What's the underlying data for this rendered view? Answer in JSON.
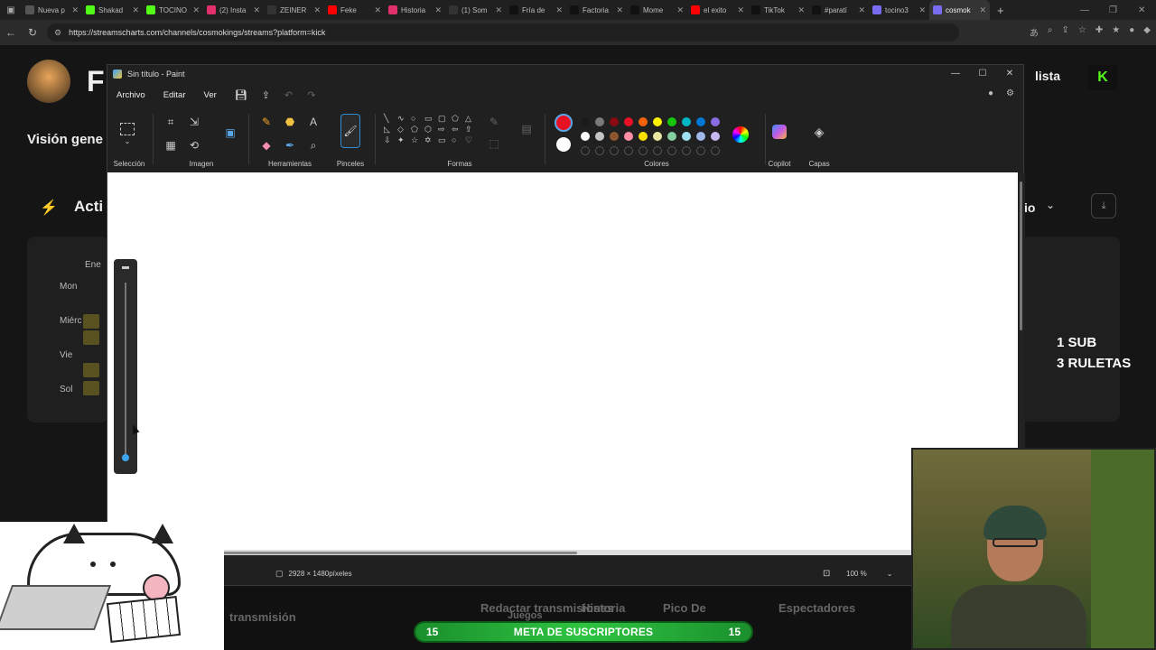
{
  "browser": {
    "tabs": [
      {
        "label": "Nueva p",
        "color": "#555555"
      },
      {
        "label": "Shakad",
        "color": "#53fc18"
      },
      {
        "label": "TOCINO",
        "color": "#53fc18"
      },
      {
        "label": "(2) Insta",
        "color": "#e1306c"
      },
      {
        "label": "ZEINER",
        "color": "#333333"
      },
      {
        "label": "Feke",
        "color": "#ff0000"
      },
      {
        "label": "Historia",
        "color": "#e1306c"
      },
      {
        "label": "(1) Som",
        "color": "#333333"
      },
      {
        "label": "Fría de",
        "color": "#111111"
      },
      {
        "label": "Factoria",
        "color": "#111111"
      },
      {
        "label": "Mome",
        "color": "#111111"
      },
      {
        "label": "el exito",
        "color": "#ff0000"
      },
      {
        "label": "TikTok",
        "color": "#111111"
      },
      {
        "label": "#paratí",
        "color": "#111111"
      },
      {
        "label": "tocino3",
        "color": "#7a6cf0"
      },
      {
        "label": "cosmok",
        "color": "#7a6cf0"
      }
    ],
    "active_tab_index": 15,
    "url": "https://streamscharts.com/channels/cosmokings/streams?platform=kick"
  },
  "background_page": {
    "logo_letter": "F",
    "section_title": "Visión gene",
    "activity_title": "Acti",
    "month_label": "Ene",
    "days": [
      "Mon",
      "Miérc",
      "Vie",
      "Sol"
    ],
    "watchlist_label": "lista",
    "kick_letter": "K",
    "right_select_label": "io",
    "sub_overlay_line1": "1 SUB",
    "sub_overlay_line2": "3 RULETAS",
    "bottom_labels": [
      "Redactar transmisiones",
      "Historia",
      "Juegos",
      "Pico De",
      "Espectadores",
      "transmisión"
    ]
  },
  "paint": {
    "title": "Sin título - Paint",
    "menu": [
      "Archivo",
      "Editar",
      "Ver"
    ],
    "groups": {
      "selection": "Selección",
      "image": "Imagen",
      "tools": "Herramientas",
      "brushes": "Pinceles",
      "shapes": "Formas",
      "colors": "Colores",
      "copilot": "Copilot",
      "layers": "Capas"
    },
    "primary_color": "#e81123",
    "secondary_color": "#ffffff",
    "palette_row1": [
      "#1a1a1a",
      "#7a7a7a",
      "#8b0a14",
      "#e81123",
      "#f7630c",
      "#fff100",
      "#16c60c",
      "#00b7c3",
      "#0078d4",
      "#886ce4"
    ],
    "palette_row2": [
      "#ffffff",
      "#c3c3c3",
      "#8e562e",
      "#ff8fa3",
      "#fce100",
      "#e6e6a0",
      "#84d0a0",
      "#9ee0f0",
      "#a0b8e8",
      "#c8b8f0"
    ],
    "canvas_size": "2928 × 1480píxeles",
    "zoom": "100 %"
  },
  "stream_overlay": {
    "goal_left": "15",
    "goal_title": "META DE SUSCRIPTORES",
    "goal_right": "15"
  }
}
